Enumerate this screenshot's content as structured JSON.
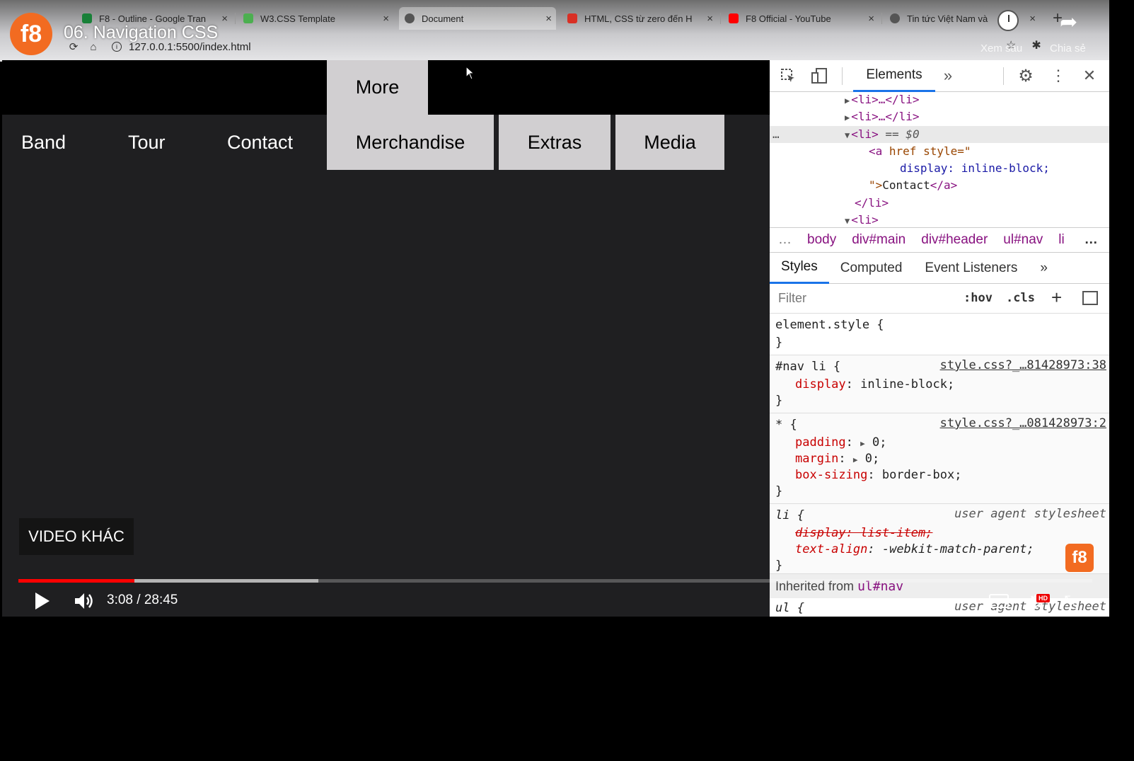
{
  "browser": {
    "tabs": [
      {
        "title": "F8 - Outline - Google Tran",
        "icon": "sheets-icon",
        "color": "#188038"
      },
      {
        "title": "W3.CSS Template",
        "icon": "w3-icon",
        "color": "#4caf50"
      },
      {
        "title": "Document",
        "icon": "globe-icon",
        "color": "#555555"
      },
      {
        "title": "HTML, CSS từ zero đến H",
        "icon": "f8-icon",
        "color": "#d93025"
      },
      {
        "title": "F8 Official - YouTube",
        "icon": "youtube-icon",
        "color": "#ff0000"
      },
      {
        "title": "Tin tức Việt Nam và",
        "icon": "globe-icon",
        "color": "#555555"
      }
    ],
    "close_glyph": "×",
    "new_tab_glyph": "+",
    "url": "127.0.0.1:5500/index.html"
  },
  "video": {
    "channel_logo": "f8",
    "title": "06. Navigation CSS",
    "watch_later": "Xem sau",
    "share": "Chia sẻ",
    "more_videos": "VIDEO KHÁC",
    "time": "3:08 / 28:45",
    "played_fraction": 0.108,
    "loaded_fraction": 0.279,
    "hd_badge": "HD",
    "watermark": "f8"
  },
  "page": {
    "nav": {
      "more": "More",
      "band": "Band",
      "tour": "Tour",
      "contact": "Contact",
      "merchandise": "Merchandise",
      "extras": "Extras",
      "media": "Media"
    }
  },
  "devtools": {
    "tab_elements": "Elements",
    "more_tabs": "»",
    "dom": {
      "li1": "<li>…</li>",
      "li2": "<li>…</li>",
      "li_selected": "<li>",
      "selected_marker": "== $0",
      "a_open": "<a",
      "a_attr_href": "href",
      "a_attr_style": "style=\"",
      "a_style_value": "display: inline-block;",
      "a_close_quote": "\">",
      "a_text": "Contact",
      "a_end": "</a>",
      "li_end": "</li>",
      "li_next": "<li>",
      "ellipsis": "…"
    },
    "breadcrumb": {
      "lead": "…",
      "items": [
        "body",
        "div#main",
        "div#header",
        "ul#nav",
        "li"
      ],
      "trail": "…"
    },
    "subtabs": [
      "Styles",
      "Computed",
      "Event Listeners",
      "»"
    ],
    "filter_placeholder": "Filter",
    "hov": ":hov",
    "cls": ".cls",
    "plus": "+",
    "rules": {
      "element_style": "element.style {",
      "close": "}",
      "nav_li_selector": "#nav li {",
      "nav_li_source": "style.css?_…81428973:38",
      "nav_li_prop": "display",
      "nav_li_value": "inline-block;",
      "star_selector": "* {",
      "star_source": "style.css?_…081428973:2",
      "padding_prop": "padding",
      "padding_value": "0;",
      "margin_prop": "margin",
      "margin_value": "0;",
      "boxsizing_prop": "box-sizing",
      "boxsizing_value": "border-box;",
      "li_selector": "li {",
      "ua_label": "user agent stylesheet",
      "li_display": "display: list-item;",
      "li_textalign_prop": "text-align",
      "li_textalign_value": "-webkit-match-parent;",
      "inherited_label": "Inherited from",
      "inherited_from": "ul#nav",
      "ul_selector": "ul {",
      "ul_ua": "user agent stylesheet"
    }
  }
}
